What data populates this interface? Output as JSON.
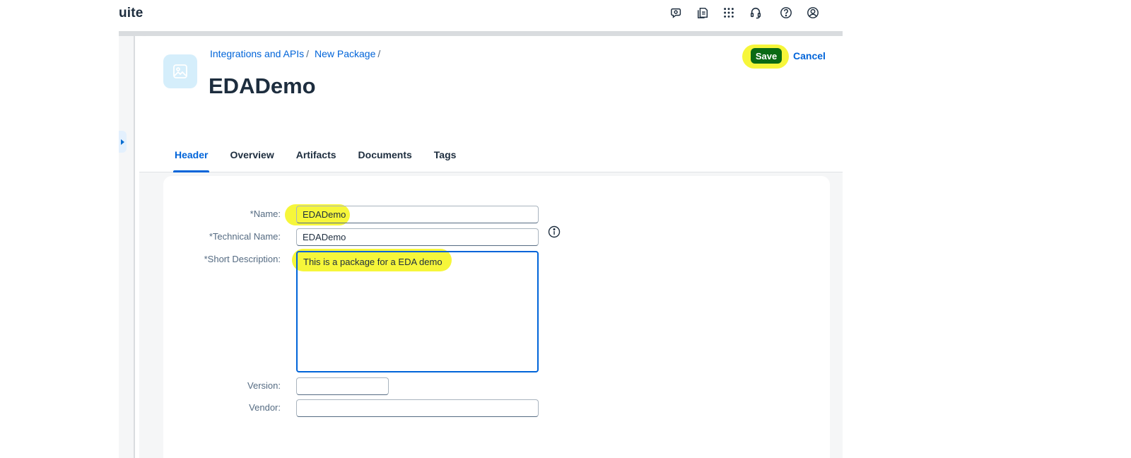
{
  "shell": {
    "brand_fragment": "uite",
    "icons": [
      "notifications-chat-icon",
      "documents-icon",
      "app-grid-icon",
      "support-headset-icon",
      "help-icon",
      "user-profile-icon"
    ]
  },
  "header": {
    "breadcrumb": [
      "Integrations and APIs",
      "New Package"
    ],
    "breadcrumb_sep": "/",
    "title": "EDADemo",
    "save_label": "Save",
    "cancel_label": "Cancel",
    "avatar_icon": "image-placeholder-icon"
  },
  "tabs": [
    {
      "label": "Header",
      "active": true
    },
    {
      "label": "Overview",
      "active": false
    },
    {
      "label": "Artifacts",
      "active": false
    },
    {
      "label": "Documents",
      "active": false
    },
    {
      "label": "Tags",
      "active": false
    }
  ],
  "form": {
    "name": {
      "label": "*Name:",
      "value": "EDADemo"
    },
    "technical_name": {
      "label": "*Technical Name:",
      "value": "EDADemo"
    },
    "short_description": {
      "label": "*Short Description:",
      "value": "This is a package for a EDA demo"
    },
    "version": {
      "label": "Version:",
      "value": ""
    },
    "vendor": {
      "label": "Vendor:",
      "value": ""
    }
  },
  "colors": {
    "accent": "#0064d9",
    "save_bg": "#0a6a14",
    "highlight": "#f6f63a"
  }
}
